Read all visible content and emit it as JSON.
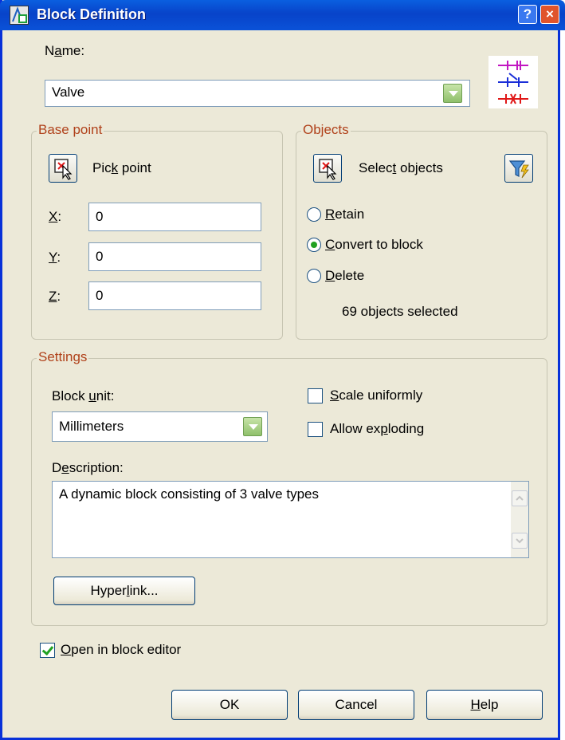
{
  "window": {
    "title": "Block Definition",
    "help_btn": "?",
    "close_btn": "×"
  },
  "name": {
    "label_pre": "N",
    "label_u": "a",
    "label_post": "me:",
    "value": "Valve"
  },
  "base_point": {
    "legend": "Base point",
    "pick_pre": "Pic",
    "pick_u": "k",
    "pick_post": " point",
    "x_u": "X",
    "x_post": ":",
    "x_value": "0",
    "y_u": "Y",
    "y_post": ":",
    "y_value": "0",
    "z_u": "Z",
    "z_post": ":",
    "z_value": "0"
  },
  "objects": {
    "legend": "Objects",
    "select_pre": "Selec",
    "select_u": "t",
    "select_post": " objects",
    "retain_u": "R",
    "retain_post": "etain",
    "convert_u": "C",
    "convert_post": "onvert to block",
    "delete_u": "D",
    "delete_post": "elete",
    "selected_mode": "convert",
    "status": "69 objects selected"
  },
  "settings": {
    "legend": "Settings",
    "unit_pre": "Block ",
    "unit_u": "u",
    "unit_post": "nit:",
    "unit_value": "Millimeters",
    "scale_u": "S",
    "scale_post": "cale uniformly",
    "scale_checked": false,
    "explode_pre": "Allow ex",
    "explode_u": "p",
    "explode_post": "loding",
    "explode_checked": false,
    "desc_pre": "D",
    "desc_u": "e",
    "desc_post": "scription:",
    "description": "A dynamic block consisting of 3 valve types",
    "hyperlink_pre": "Hyper",
    "hyperlink_u": "l",
    "hyperlink_post": "ink..."
  },
  "open_editor": {
    "u": "O",
    "post": "pen in block editor",
    "checked": true
  },
  "buttons": {
    "ok": "OK",
    "cancel": "Cancel",
    "help_u": "H",
    "help_post": "elp"
  },
  "colors": {
    "titlebar": "#0a5fe0",
    "legend_text": "#b0411a",
    "dialog_bg": "#ece9d8"
  }
}
